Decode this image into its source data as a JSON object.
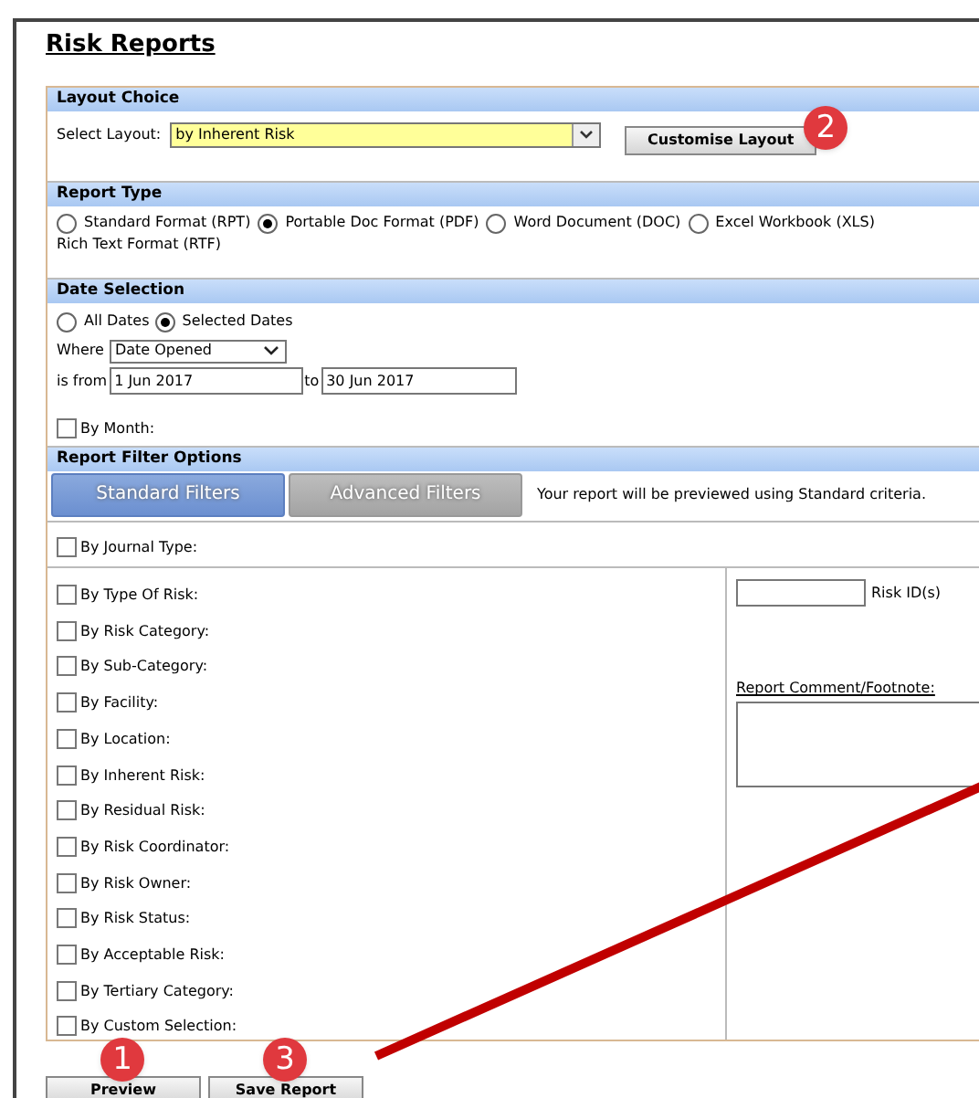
{
  "title": "Risk Reports",
  "layout_choice": {
    "heading": "Layout Choice",
    "label": "Select Layout:",
    "value": "by Inherent Risk",
    "button": {
      "label": "Customise Layout",
      "badge": "2"
    }
  },
  "report_type": {
    "heading": "Report Type",
    "options": [
      {
        "label": "Standard Format (RPT)",
        "selected": false
      },
      {
        "label": "Portable Doc Format (PDF)",
        "selected": true
      },
      {
        "label": "Word Document (DOC)",
        "selected": false
      },
      {
        "label": "Excel Workbook (XLS)",
        "selected": false
      },
      {
        "label": "Rich Text Format (RTF)",
        "selected": false
      }
    ]
  },
  "date_selection": {
    "heading": "Date Selection",
    "modes": [
      {
        "label": "All Dates",
        "selected": false
      },
      {
        "label": "Selected Dates",
        "selected": true
      }
    ],
    "where_label": "Where",
    "where_value": "Date Opened",
    "from_label": "is from",
    "from_value": "1 Jun 2017",
    "to_label": "to",
    "to_value": "30 Jun 2017",
    "by_month": {
      "label": "By Month:",
      "checked": false
    }
  },
  "filter_options": {
    "heading": "Report Filter Options",
    "tabs": [
      {
        "label": "Standard Filters",
        "selected": true
      },
      {
        "label": "Advanced Filters",
        "selected": false
      }
    ],
    "note": "Your report will be previewed using Standard criteria.",
    "journal": {
      "label": "By Journal Type:",
      "checked": false
    },
    "filters": [
      {
        "label": "By Type Of Risk:",
        "checked": false
      },
      {
        "label": "By Risk Category:",
        "checked": false
      },
      {
        "label": "By Sub-Category:",
        "checked": false
      },
      {
        "label": "By Facility:",
        "checked": false
      },
      {
        "label": "By Location:",
        "checked": false
      },
      {
        "label": "By Inherent Risk:",
        "checked": false
      },
      {
        "label": "By Residual Risk:",
        "checked": false
      },
      {
        "label": "By Risk Coordinator:",
        "checked": false
      },
      {
        "label": "By Risk Owner:",
        "checked": false
      },
      {
        "label": "By Risk Status:",
        "checked": false
      },
      {
        "label": "By Acceptable Risk:",
        "checked": false
      },
      {
        "label": "By Tertiary Category:",
        "checked": false
      },
      {
        "label": "By Custom Selection:",
        "checked": false
      }
    ],
    "risk_ids_label": "Risk ID(s)",
    "comment_label": "Report Comment/Footnote:"
  },
  "buttons": [
    {
      "label": "Preview",
      "badge": "1"
    },
    {
      "label": "Save Report",
      "badge": "3"
    }
  ]
}
